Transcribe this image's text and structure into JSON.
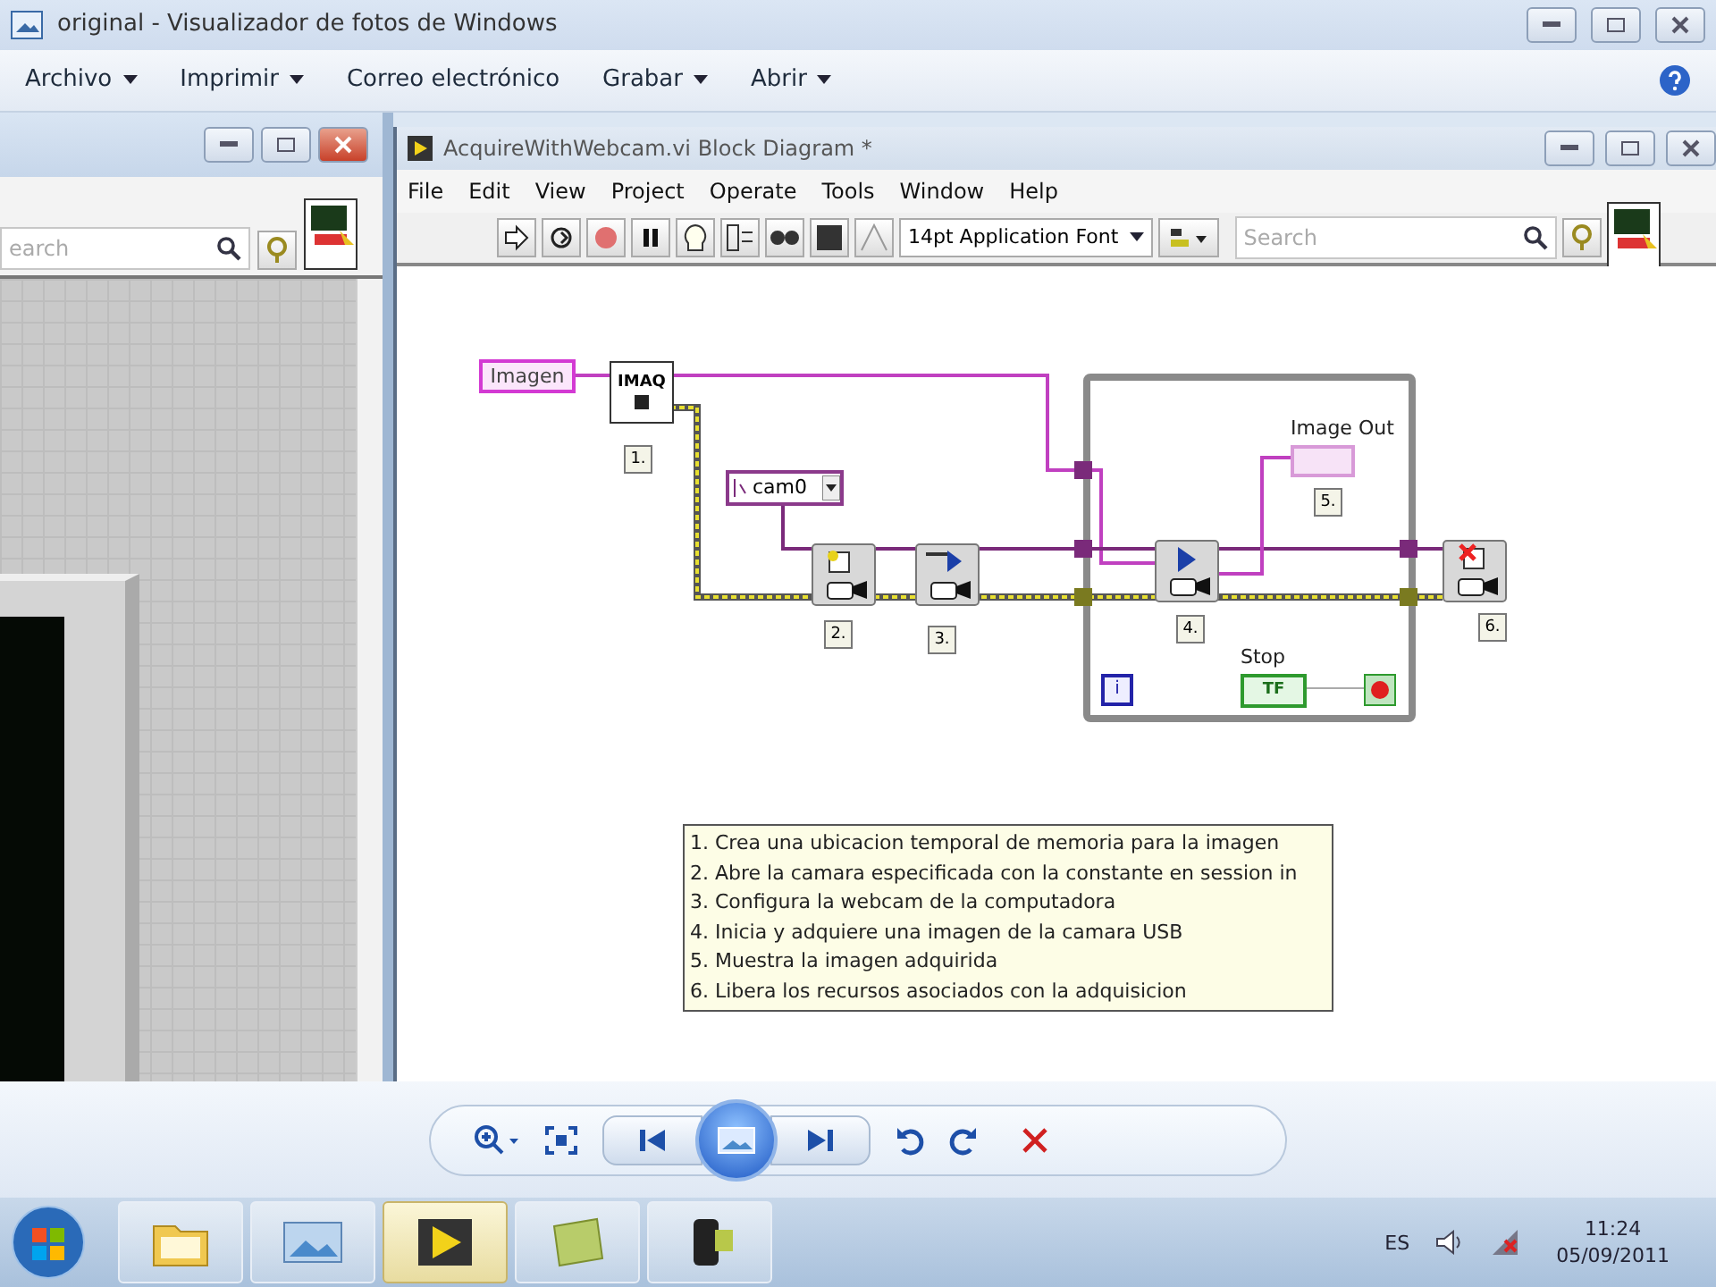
{
  "window": {
    "title": "original - Visualizador de fotos de Windows"
  },
  "menu": [
    {
      "label": "Archivo",
      "caret": true
    },
    {
      "label": "Imprimir",
      "caret": true
    },
    {
      "label": "Correo electrónico",
      "caret": false
    },
    {
      "label": "Grabar",
      "caret": true
    },
    {
      "label": "Abrir",
      "caret": true
    }
  ],
  "front_panel": {
    "search_placeholder": "earch"
  },
  "block_diagram": {
    "title": "AcquireWithWebcam.vi Block Diagram *",
    "menu": [
      "File",
      "Edit",
      "View",
      "Project",
      "Operate",
      "Tools",
      "Window",
      "Help"
    ],
    "font": "14pt Application Font",
    "search_placeholder": "Search",
    "constant": "Imagen",
    "camera": "cam0",
    "indicator_label": "Image Out",
    "stop_label": "Stop",
    "stop_value": "TF",
    "iteration": "i",
    "nodes": [
      {
        "kind": "create",
        "text": "IMAQ",
        "step": "1."
      },
      {
        "kind": "open",
        "step": "2."
      },
      {
        "kind": "configure",
        "step": "3."
      },
      {
        "kind": "grab",
        "step": "4."
      },
      {
        "kind": "display",
        "step": "5."
      },
      {
        "kind": "close",
        "step": "6."
      }
    ],
    "comment": [
      "1. Crea una ubicacion temporal de memoria para la imagen",
      "2. Abre la camara especificada con la constante en session in",
      "3. Configura la webcam de la computadora",
      "4.  Inicia y adquiere una imagen de la camara USB",
      "5. Muestra la imagen adquirida",
      "6. Libera los recursos asociados con la adquisicion"
    ]
  },
  "taskbar": {
    "language": "ES",
    "time": "11:24",
    "date": "05/09/2011",
    "apps": [
      {
        "kind": "folder",
        "selected": false
      },
      {
        "kind": "photos",
        "selected": false
      },
      {
        "kind": "labview",
        "selected": true
      },
      {
        "kind": "notes",
        "selected": false
      },
      {
        "kind": "camera",
        "selected": false
      }
    ]
  }
}
